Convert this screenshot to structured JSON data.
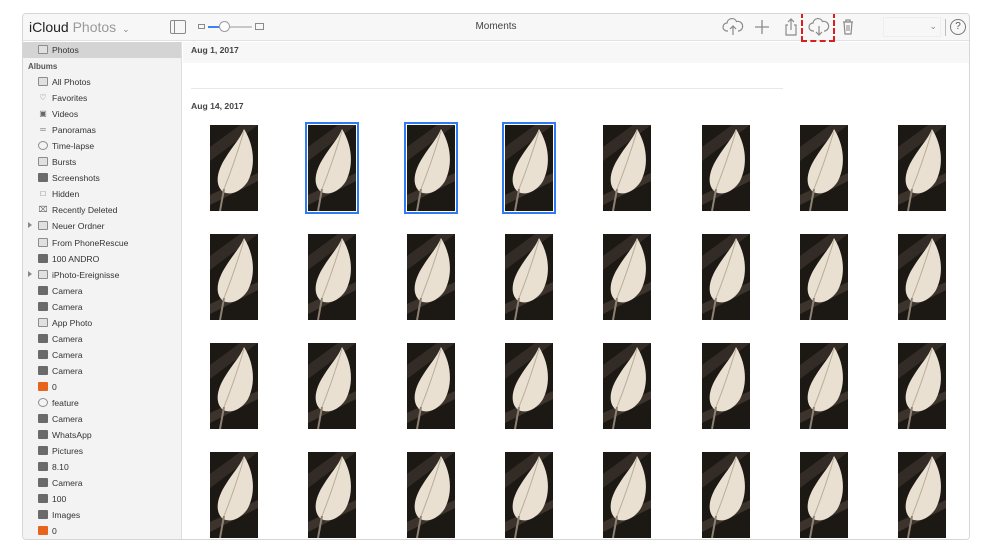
{
  "header": {
    "brand": "iCloud",
    "app_name": "Photos",
    "title": "Moments",
    "toolbar_icons": [
      "upload-icon",
      "add-icon",
      "share-icon",
      "download-icon",
      "trash-icon"
    ],
    "help_label": "?"
  },
  "sidebar": {
    "albums_header": "Albums",
    "items": [
      {
        "label": "Photos",
        "icon": "photos-icon",
        "selected": true
      },
      {
        "label": "All Photos",
        "icon": "all-photos-icon"
      },
      {
        "label": "Favorites",
        "icon": "heart-icon"
      },
      {
        "label": "Videos",
        "icon": "video-icon"
      },
      {
        "label": "Panoramas",
        "icon": "panorama-icon"
      },
      {
        "label": "Time-lapse",
        "icon": "timelapse-icon"
      },
      {
        "label": "Bursts",
        "icon": "bursts-icon"
      },
      {
        "label": "Screenshots",
        "icon": "screenshot-icon"
      },
      {
        "label": "Hidden",
        "icon": "hidden-icon"
      },
      {
        "label": "Recently Deleted",
        "icon": "trash-icon"
      },
      {
        "label": "Neuer Ordner",
        "icon": "folder-icon",
        "expandable": true
      },
      {
        "label": "From PhoneRescue",
        "icon": "album-icon"
      },
      {
        "label": "100 ANDRO",
        "icon": "album-thumb-icon"
      },
      {
        "label": "iPhoto-Ereignisse",
        "icon": "folder-icon",
        "expandable": true
      },
      {
        "label": "Camera",
        "icon": "album-thumb-icon"
      },
      {
        "label": "Camera",
        "icon": "album-thumb-icon"
      },
      {
        "label": "App Photo",
        "icon": "app-photo-icon"
      },
      {
        "label": "Camera",
        "icon": "album-thumb-icon"
      },
      {
        "label": "Camera",
        "icon": "album-thumb-icon"
      },
      {
        "label": "Camera",
        "icon": "album-thumb-icon"
      },
      {
        "label": "0",
        "icon": "album-orange-icon"
      },
      {
        "label": "feature",
        "icon": "feature-icon"
      },
      {
        "label": "Camera",
        "icon": "album-thumb-icon"
      },
      {
        "label": "WhatsApp",
        "icon": "album-thumb-icon"
      },
      {
        "label": "Pictures",
        "icon": "album-thumb-icon"
      },
      {
        "label": "8.10",
        "icon": "album-thumb-icon"
      },
      {
        "label": "Camera",
        "icon": "album-thumb-icon"
      },
      {
        "label": "100",
        "icon": "album-thumb-icon"
      },
      {
        "label": "Images",
        "icon": "album-thumb-icon"
      },
      {
        "label": "0",
        "icon": "album-orange-icon"
      }
    ]
  },
  "moments": [
    {
      "date": "Aug 1, 2017"
    },
    {
      "date": "Aug 14, 2017",
      "photo_count": 32,
      "selected_photos": [
        1,
        2,
        3
      ]
    }
  ],
  "colors": {
    "selection": "#2f7bef",
    "highlight": "#d42020"
  }
}
